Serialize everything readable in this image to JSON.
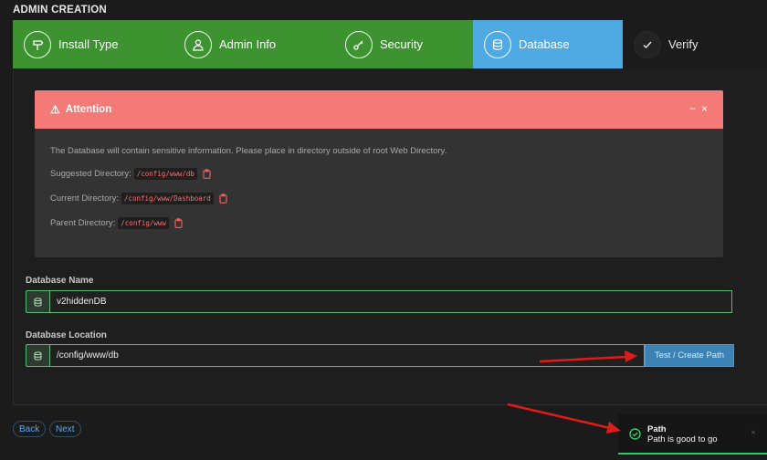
{
  "page": {
    "title": "ADMIN CREATION"
  },
  "steps": [
    {
      "label": "Install Type",
      "icon": "signpost-icon",
      "state": "done"
    },
    {
      "label": "Admin Info",
      "icon": "user-icon",
      "state": "done"
    },
    {
      "label": "Security",
      "icon": "key-icon",
      "state": "done"
    },
    {
      "label": "Database",
      "icon": "database-icon",
      "state": "active"
    },
    {
      "label": "Verify",
      "icon": "check-icon",
      "state": "todo"
    }
  ],
  "alert": {
    "title": "Attention",
    "minimize": "−",
    "close": "×",
    "message": "The Database will contain sensitive information. Please place in directory outside of root Web Directory.",
    "suggested_label": "Suggested Directory:",
    "suggested_value": "/config/www/db",
    "current_label": "Current Directory:",
    "current_value": "/config/www/Dashboard",
    "parent_label": "Parent Directory:",
    "parent_value": "/config/www"
  },
  "fields": {
    "db_name_label": "Database Name",
    "db_name_value": "v2hiddenDB",
    "db_location_label": "Database Location",
    "db_location_value": "/config/www/db",
    "test_button": "Test / Create Path"
  },
  "nav": {
    "back": "Back",
    "next": "Next"
  },
  "toast": {
    "title": "Path",
    "message": "Path is good to go",
    "close": "×"
  },
  "colors": {
    "done": "#3c9330",
    "active": "#4fa9e3",
    "alert": "#f47a78",
    "field_border": "#4fbf6c",
    "toast_accent": "#39c46a",
    "annotation_arrow": "#e01b1b"
  }
}
